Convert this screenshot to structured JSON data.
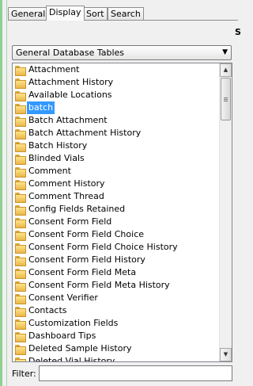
{
  "tabs": [
    "General",
    "Display",
    "Sort",
    "Search"
  ],
  "active_tab": "Display",
  "side_letter": "S",
  "dropdown": {
    "selected": "General Database Tables"
  },
  "list": {
    "items": [
      "Attachment",
      "Attachment History",
      "Available Locations",
      "batch",
      "Batch Attachment",
      "Batch Attachment History",
      "Batch History",
      "Blinded Vials",
      "Comment",
      "Comment History",
      "Comment Thread",
      "Config Fields Retained",
      "Consent Form Field",
      "Consent Form Field Choice",
      "Consent Form Field Choice History",
      "Consent Form Field History",
      "Consent Form Field Meta",
      "Consent Form Field Meta History",
      "Consent Verifier",
      "Contacts",
      "Customization Fields",
      "Dashboard Tips",
      "Deleted Sample History",
      "Deleted Vial History"
    ],
    "selected_index": 3
  },
  "filter": {
    "label": "Filter:",
    "value": ""
  }
}
